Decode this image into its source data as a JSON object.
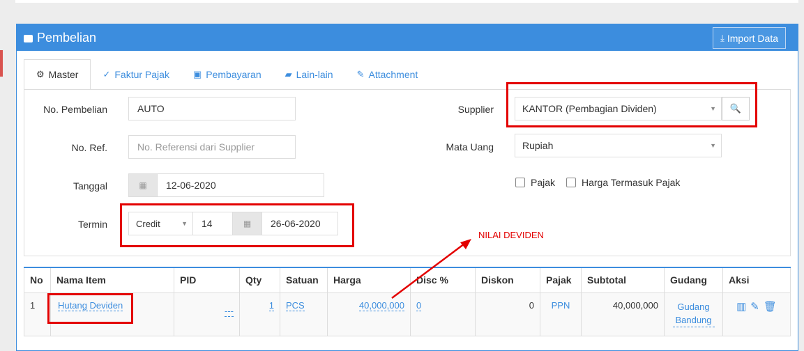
{
  "panel": {
    "title": "Pembelian",
    "import_label": "Import Data"
  },
  "tabs": [
    {
      "label": "Master",
      "icon": "gears-icon",
      "active": true
    },
    {
      "label": "Faktur Pajak",
      "icon": "check-circle-icon"
    },
    {
      "label": "Pembayaran",
      "icon": "money-icon"
    },
    {
      "label": "Lain-lain",
      "icon": "truck-icon"
    },
    {
      "label": "Attachment",
      "icon": "paperclip-icon"
    }
  ],
  "form": {
    "no_pembelian_label": "No. Pembelian",
    "no_pembelian_value": "AUTO",
    "no_ref_label": "No. Ref.",
    "no_ref_placeholder": "No. Referensi dari Supplier",
    "tanggal_label": "Tanggal",
    "tanggal_value": "12-06-2020",
    "termin_label": "Termin",
    "termin_type": "Credit",
    "termin_days": "14",
    "termin_due": "26-06-2020",
    "supplier_label": "Supplier",
    "supplier_value": "KANTOR (Pembagian Dividen)",
    "mata_uang_label": "Mata Uang",
    "mata_uang_value": "Rupiah",
    "pajak_label": "Pajak",
    "harga_pajak_label": "Harga Termasuk Pajak"
  },
  "annotation": {
    "text": "NILAI DEVIDEN"
  },
  "table": {
    "headers": [
      "No",
      "Nama Item",
      "PID",
      "Qty",
      "Satuan",
      "Harga",
      "Disc %",
      "Diskon",
      "Pajak",
      "Subtotal",
      "Gudang",
      "Aksi"
    ],
    "rows": [
      {
        "no": "1",
        "nama": "Hutang Deviden",
        "pid": "---",
        "qty": "1",
        "satuan": "PCS",
        "harga": "40,000,000",
        "disc": "0",
        "diskon": "0",
        "pajak": "PPN",
        "subtotal": "40,000,000",
        "gudang": "Gudang Bandung"
      }
    ]
  },
  "colors": {
    "accent": "#3c8dde",
    "annotation": "#e30000"
  }
}
